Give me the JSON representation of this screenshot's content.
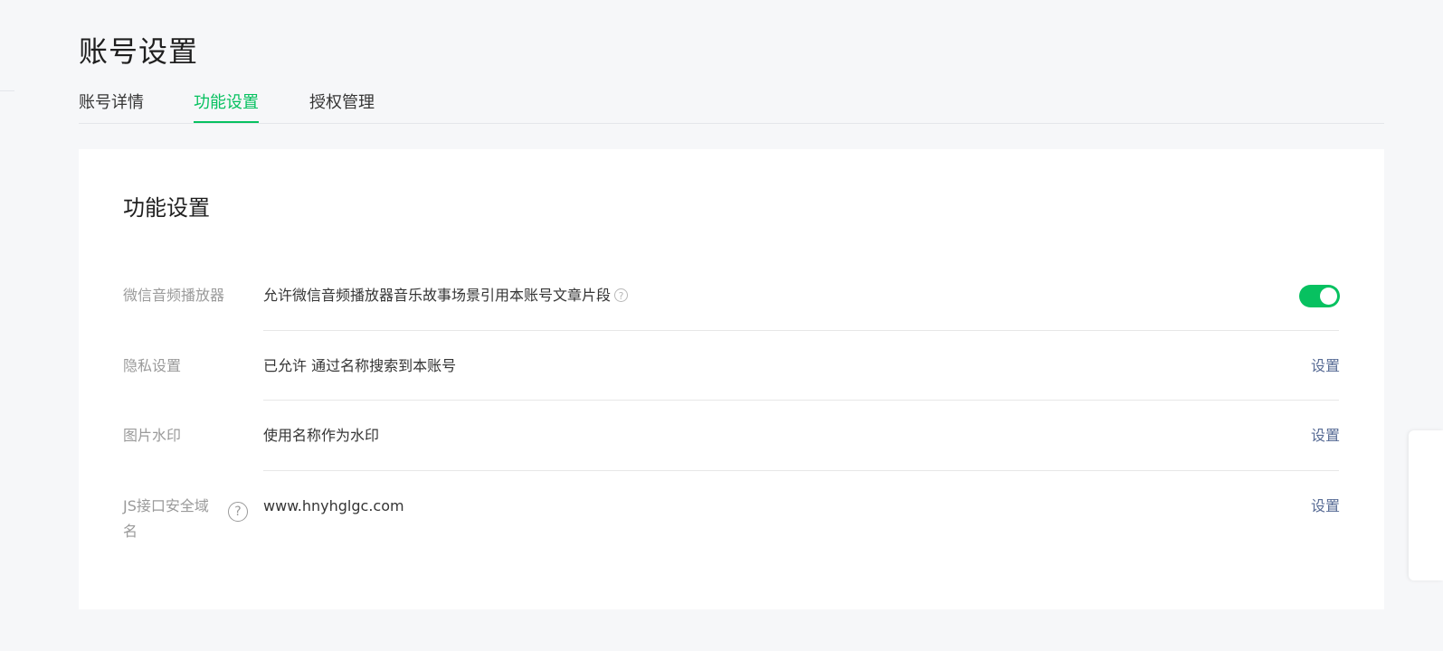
{
  "page": {
    "title": "账号设置"
  },
  "tabs": [
    {
      "label": "账号详情",
      "active": false
    },
    {
      "label": "功能设置",
      "active": true
    },
    {
      "label": "授权管理",
      "active": false
    }
  ],
  "card": {
    "title": "功能设置",
    "rows": [
      {
        "label": "微信音频播放器",
        "value": "允许微信音频播放器音乐故事场景引用本账号文章片段",
        "help_icon": "question-circle-icon",
        "toggle_on": true
      },
      {
        "label": "隐私设置",
        "value": "已允许 通过名称搜索到本账号",
        "action": "设置"
      },
      {
        "label": "图片水印",
        "value": "使用名称作为水印",
        "action": "设置"
      },
      {
        "label": "JS接口安全域名",
        "value": "www.hnyhglgc.com",
        "help_icon": "question-circle-icon",
        "action": "设置"
      }
    ]
  },
  "colors": {
    "accent": "#07c160",
    "link": "#576b95",
    "label": "#9a9a9a",
    "background": "#f6f7f9"
  }
}
